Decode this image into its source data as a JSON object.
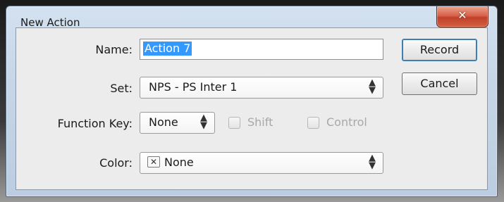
{
  "window": {
    "title": "New Action",
    "close_symbol": "✕"
  },
  "form": {
    "name_label": "Name:",
    "name_value": "Action 7",
    "set_label": "Set:",
    "set_value": "NPS - PS Inter 1",
    "function_key_label": "Function Key:",
    "function_key_value": "None",
    "shift_label": "Shift",
    "control_label": "Control",
    "color_label": "Color:",
    "color_value": "None",
    "color_swatch_symbol": "✕",
    "updown_up": "▲",
    "updown_down": "▼"
  },
  "buttons": {
    "record_label": "Record",
    "cancel_label": "Cancel"
  },
  "colors": {
    "selection": "#3399ff",
    "close_button": "#c0412b",
    "dialog_background": "#ececec"
  },
  "icons": [
    "close-icon",
    "updown-icon",
    "no-color-swatch-icon"
  ]
}
